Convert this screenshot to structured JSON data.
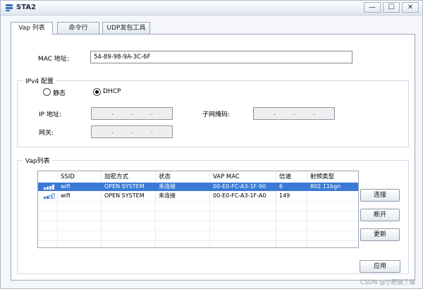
{
  "window": {
    "title": "STA2",
    "minimize_label": "—",
    "maximize_label": "☐",
    "close_label": "✕"
  },
  "tabs": [
    {
      "label": "Vap 列表",
      "active": true
    },
    {
      "label": "命令行",
      "active": false
    },
    {
      "label": "UDP发包工具",
      "active": false
    }
  ],
  "mac": {
    "label": "MAC 地址:",
    "value": "54-89-98-9A-3C-6F"
  },
  "ipv4": {
    "legend": "IPv4 配置",
    "static_label": "静态",
    "dhcp_label": "DHCP",
    "selected": "DHCP",
    "ip_label": "IP 地址:",
    "mask_label": "子网掩码:",
    "gateway_label": "网关:",
    "ip_separator": "."
  },
  "vap": {
    "legend": "Vap列表",
    "columns": [
      "SSID",
      "加密方式",
      "状态",
      "VAP MAC",
      "信道",
      "射频类型"
    ],
    "rows": [
      {
        "signal": "strong",
        "ssid": "wifi",
        "encryption": "OPEN SYSTEM",
        "status": "未连接",
        "mac": "00-E0-FC-A3-1F-90",
        "channel": "6",
        "radio": "802.11bgn",
        "selected": true
      },
      {
        "signal": "weak",
        "ssid": "wifi",
        "encryption": "OPEN SYSTEM",
        "status": "未连接",
        "mac": "00-E0-FC-A3-1F-A0",
        "channel": "149",
        "radio": "",
        "selected": false
      }
    ]
  },
  "buttons": {
    "connect": "连接",
    "disconnect": "断开",
    "refresh": "更新",
    "apply": "应用"
  },
  "watermark": "CSDN @小肥猫了猫",
  "colors": {
    "selection": "#3a7ad6",
    "signal_strong": "#3a7ad6",
    "title_text": "#1f2f46"
  }
}
